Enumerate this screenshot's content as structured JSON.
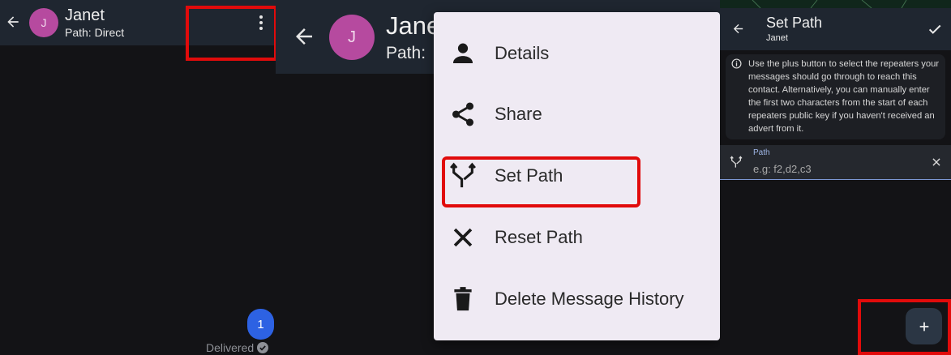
{
  "panel1": {
    "contact_initial": "J",
    "contact_name": "Janet",
    "path_status": "Path: Direct",
    "message": {
      "text": "1",
      "status": "Delivered"
    }
  },
  "panel2": {
    "contact_initial": "J",
    "contact_name_partial": "Jane",
    "path_partial": "Path:",
    "menu_items": [
      {
        "label": "Details",
        "icon": "person-icon"
      },
      {
        "label": "Share",
        "icon": "share-icon"
      },
      {
        "label": "Set Path",
        "icon": "fork-icon"
      },
      {
        "label": "Reset Path",
        "icon": "close-icon"
      },
      {
        "label": "Delete Message History",
        "icon": "trash-icon"
      }
    ]
  },
  "panel3": {
    "title": "Set Path",
    "subtitle": "Janet",
    "info_text": "Use the plus button to select the repeaters your messages should go through to reach this contact. Alternatively, you can manually enter the first two characters from the start of each repeaters public key if you haven't received an advert from it.",
    "path_field": {
      "label": "Path",
      "placeholder": "e.g: f2,d2,c3",
      "value": ""
    },
    "fab_icon": "plus-icon"
  },
  "colors": {
    "background": "#131316",
    "appbar": "#1f2630",
    "avatar": "#b64a9f",
    "bubble": "#2d62e3",
    "menu": "#efeaf3",
    "highlight": "#e10b0b",
    "field_accent": "#9fb6e6"
  }
}
